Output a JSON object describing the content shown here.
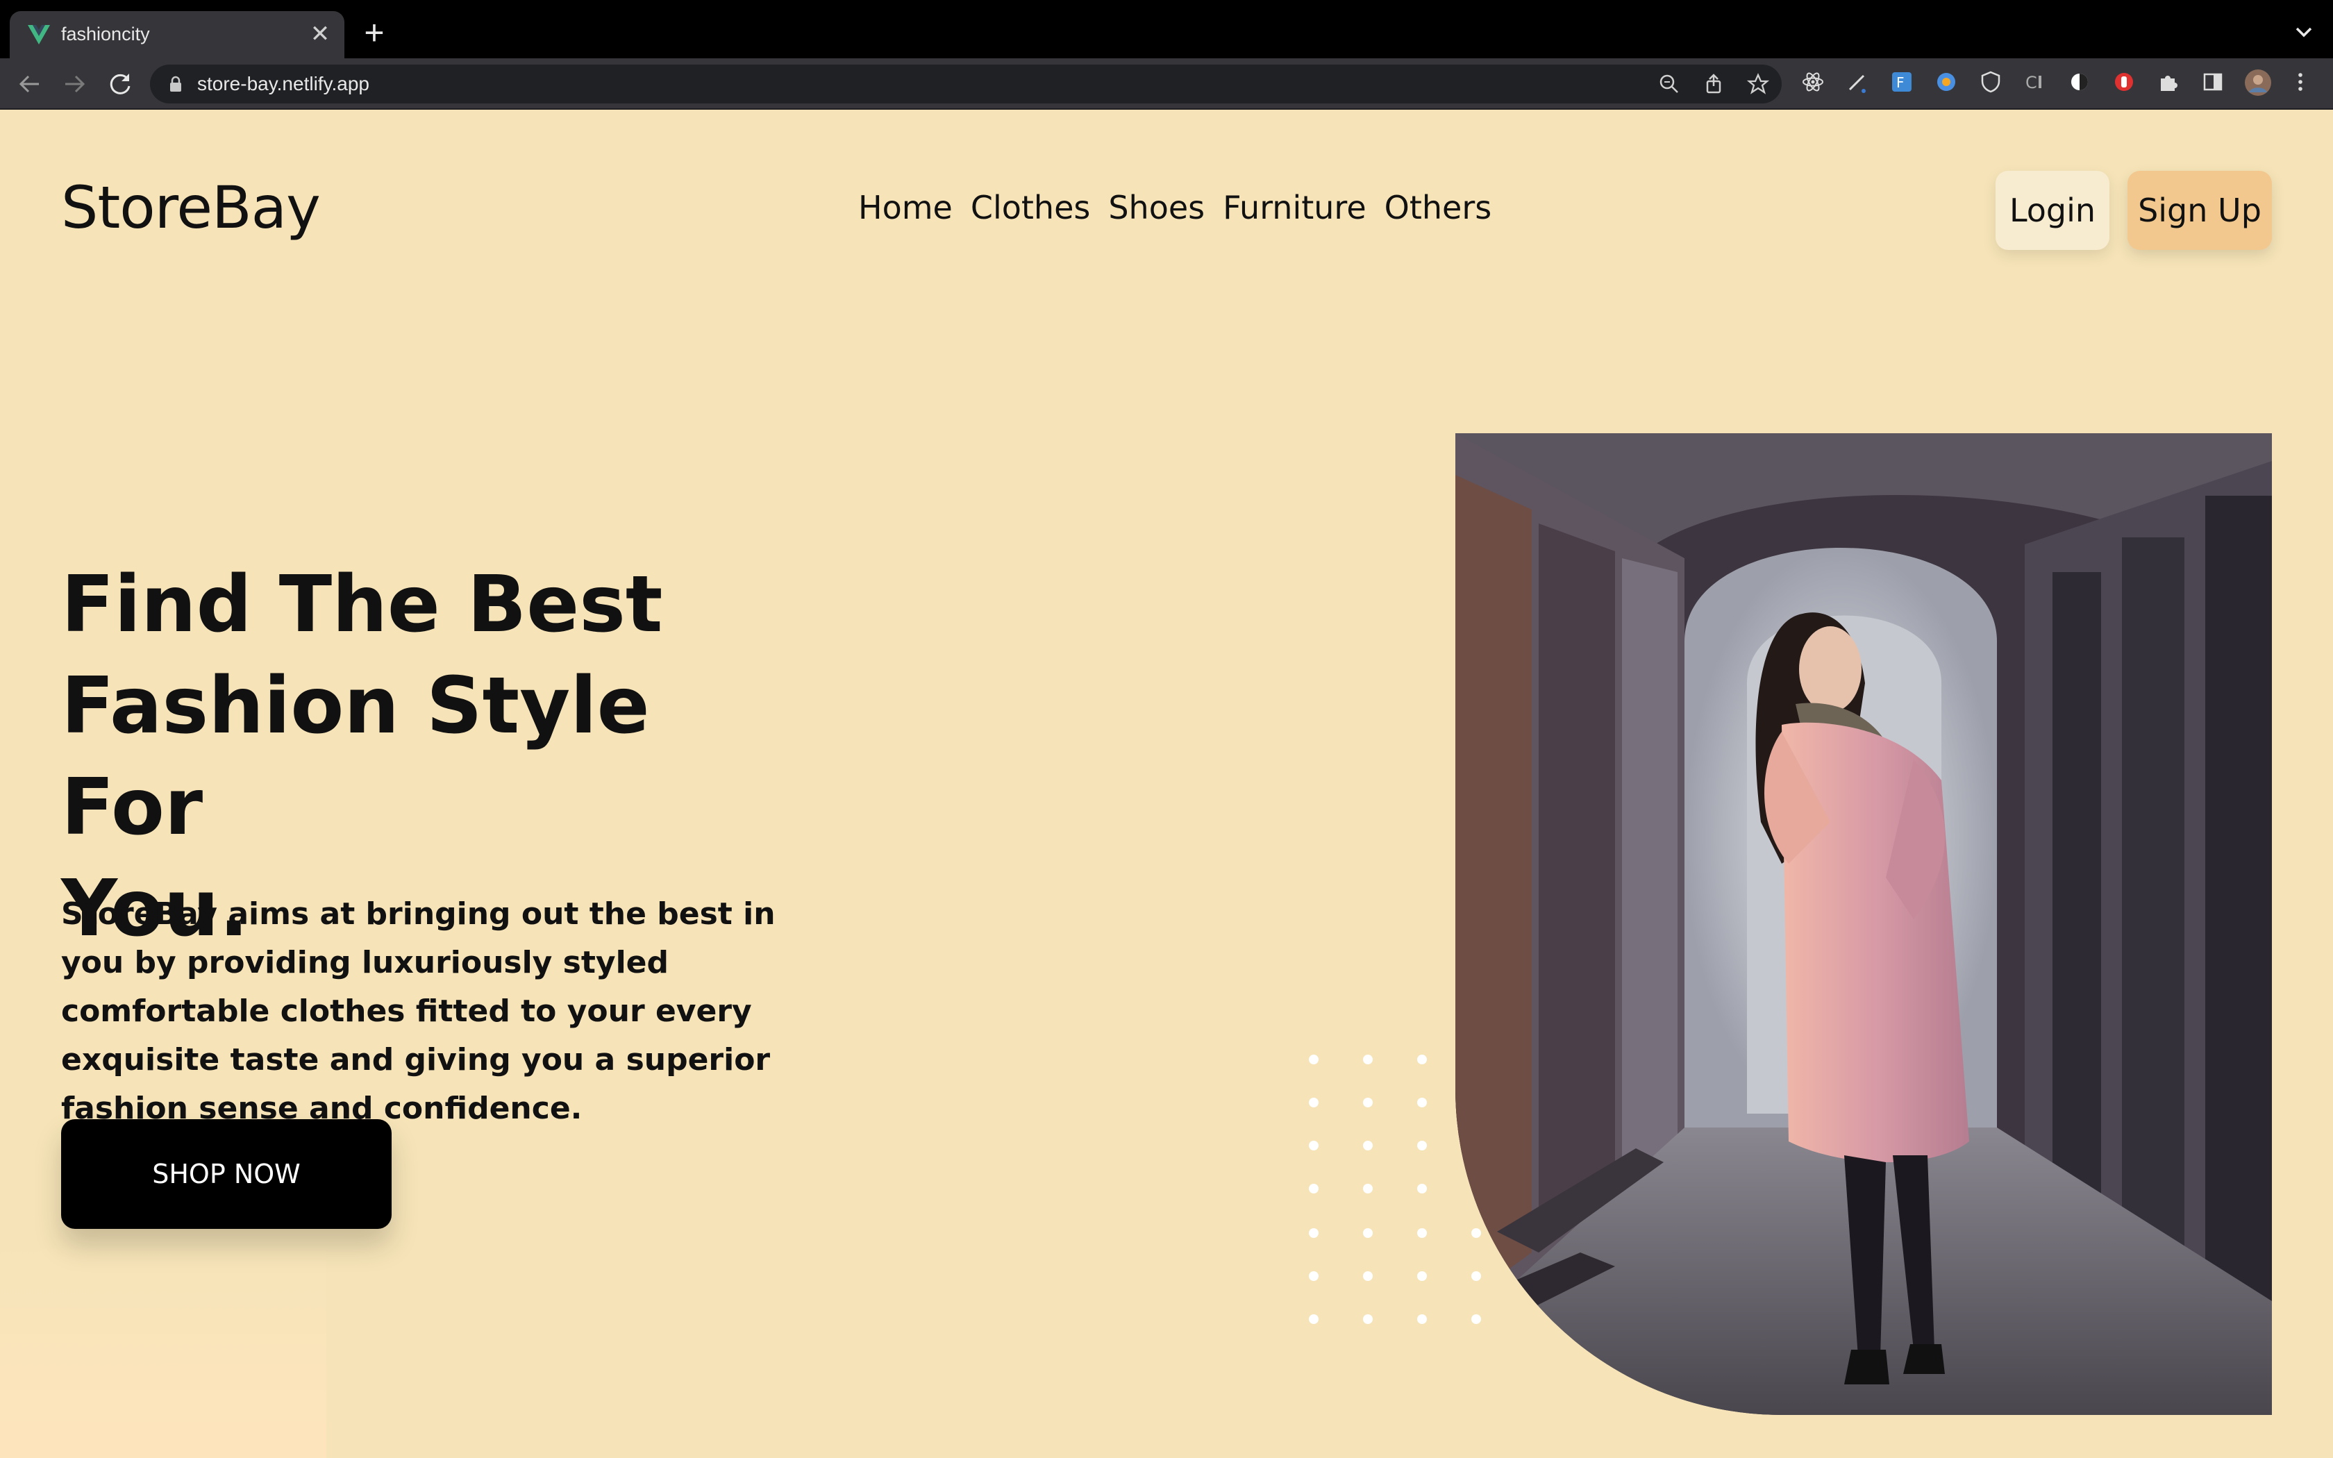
{
  "browser": {
    "tab_title": "fashioncity",
    "url": "store-bay.netlify.app",
    "tab_close_glyph": "✕",
    "new_tab_glyph": "+",
    "icons": [
      "back-arrow-icon",
      "forward-arrow-icon",
      "reload-icon",
      "lock-icon",
      "zoom-icon",
      "share-icon",
      "star-icon",
      "react-devtools-icon",
      "pen-tool-icon",
      "extension-f-icon",
      "extension-circle-icon",
      "shield-icon",
      "ci-icon",
      "dark-mode-icon",
      "stop-icon",
      "puzzle-icon",
      "sidebar-icon",
      "profile-avatar-icon",
      "kebab-menu-icon"
    ]
  },
  "site": {
    "logo": "StoreBay",
    "nav": [
      "Home",
      "Clothes",
      "Shoes",
      "Furniture",
      "Others"
    ],
    "login_label": "Login",
    "signup_label": "Sign Up"
  },
  "hero": {
    "headline_line1": "Find The Best",
    "headline_line2": "Fashion Style For",
    "headline_line3": "You.",
    "subtext": "StoreBay aims at bringing out the best in you by providing luxuriously styled comfortable clothes fitted to your every exquisite taste and giving you a superior fashion sense and confidence.",
    "cta_label": "SHOP NOW"
  },
  "colors": {
    "page_bg": "#f6e4b8",
    "signup_bg": "#f2c88e",
    "login_bg": "#f8ecd0",
    "cta_bg": "#000000"
  }
}
